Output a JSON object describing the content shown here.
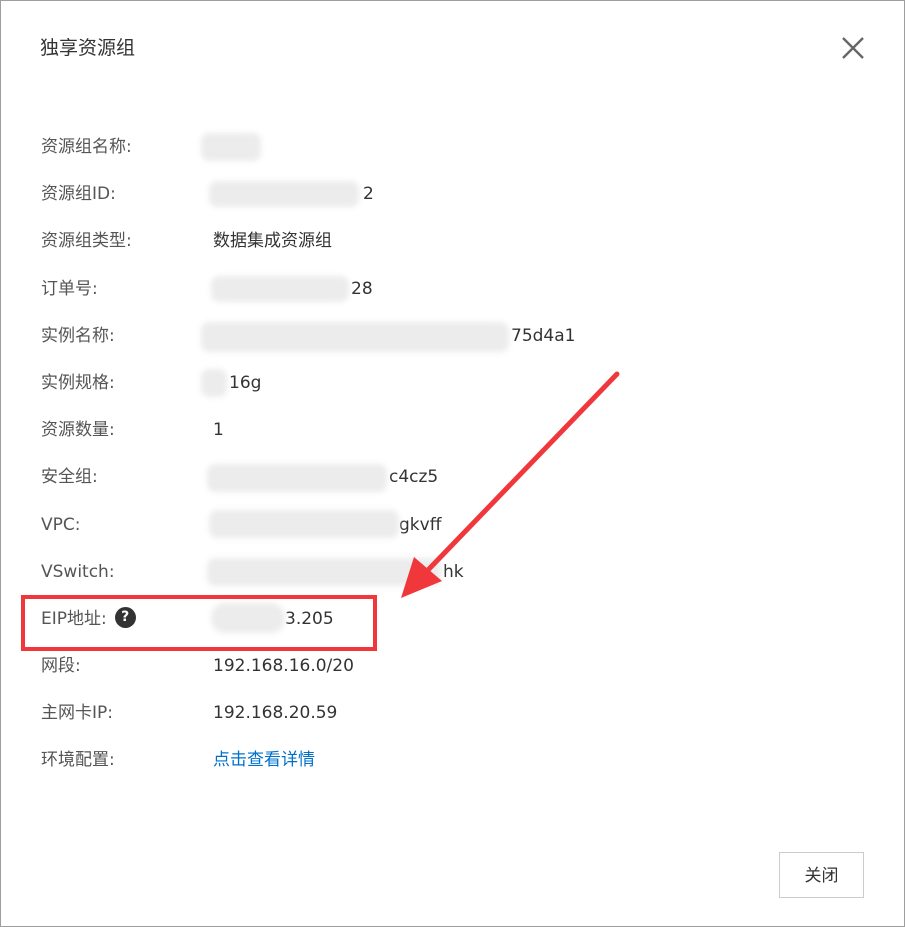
{
  "dialog": {
    "title": "独享资源组",
    "close_icon": "close-icon"
  },
  "fields": [
    {
      "label": "资源组名称:",
      "value": ""
    },
    {
      "label": "资源组ID:",
      "value": "2"
    },
    {
      "label": "资源组类型:",
      "value": "数据集成资源组"
    },
    {
      "label": "订单号:",
      "value": "28"
    },
    {
      "label": "实例名称:",
      "value": "75d4a1"
    },
    {
      "label": "实例规格:",
      "value": "16g"
    },
    {
      "label": "资源数量:",
      "value": "1"
    },
    {
      "label": "安全组:",
      "value": "c4cz5"
    },
    {
      "label": "VPC:",
      "value": "gkvff"
    },
    {
      "label": "VSwitch:",
      "value": "hk"
    },
    {
      "label": "EIP地址:",
      "value": "3.205",
      "help_icon": "question-circle-icon"
    },
    {
      "label": "网段:",
      "value": "192.168.16.0/20"
    },
    {
      "label": "主网卡IP:",
      "value": "192.168.20.59"
    },
    {
      "label": "环境配置:",
      "value": "点击查看详情",
      "is_link": true
    }
  ],
  "footer": {
    "close_label": "关闭"
  },
  "colors": {
    "annotation_red": "#f0383c",
    "link_blue": "#0070cc",
    "text_dark": "#333333",
    "label_gray": "#555555"
  }
}
